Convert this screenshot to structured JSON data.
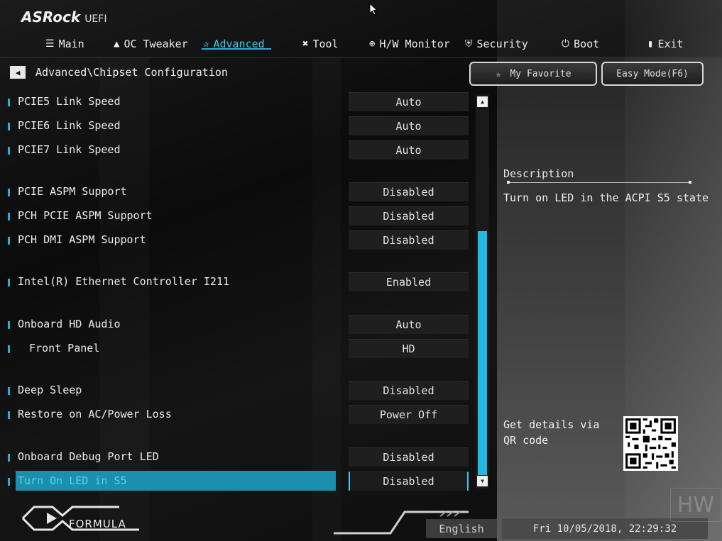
{
  "app": {
    "logo": "ASRock",
    "logo_suffix": "UEFI"
  },
  "tabs": [
    {
      "label": "Main",
      "icon": "list-icon"
    },
    {
      "label": "OC Tweaker",
      "icon": "flame-icon"
    },
    {
      "label": "Advanced",
      "icon": "star-icon",
      "active": true
    },
    {
      "label": "Tool",
      "icon": "tools-icon"
    },
    {
      "label": "H/W Monitor",
      "icon": "monitor-crosshair-icon"
    },
    {
      "label": "Security",
      "icon": "shield-icon"
    },
    {
      "label": "Boot",
      "icon": "power-icon"
    },
    {
      "label": "Exit",
      "icon": "exit-door-icon"
    }
  ],
  "breadcrumb": "Advanced\\Chipset Configuration",
  "buttons": {
    "favorite": "My Favorite",
    "easy_mode": "Easy Mode(F6)"
  },
  "settings": [
    {
      "label": "PCIE5 Link Speed",
      "value": "Auto"
    },
    {
      "label": "PCIE6 Link Speed",
      "value": "Auto"
    },
    {
      "label": "PCIE7 Link Speed",
      "value": "Auto"
    },
    {
      "label": "PCIE ASPM Support",
      "value": "Disabled"
    },
    {
      "label": "PCH PCIE ASPM Support",
      "value": "Disabled"
    },
    {
      "label": "PCH DMI ASPM Support",
      "value": "Disabled"
    },
    {
      "label": "Intel(R) Ethernet Controller I211",
      "value": "Enabled"
    },
    {
      "label": "Onboard HD Audio",
      "value": "Auto"
    },
    {
      "label": "Front Panel",
      "value": "HD"
    },
    {
      "label": "Deep Sleep",
      "value": "Disabled"
    },
    {
      "label": "Restore on AC/Power Loss",
      "value": "Power Off"
    },
    {
      "label": "Onboard Debug Port LED",
      "value": "Disabled"
    },
    {
      "label": "Turn On LED in S5",
      "value": "Disabled",
      "selected": true
    }
  ],
  "description": {
    "title": "Description",
    "text": "Turn on LED in the ACPI S5 state"
  },
  "qr_hint": "Get details via QR code",
  "footer": {
    "brand": "FORMULA",
    "language": "English",
    "datetime": "Fri 10/05/2018, 22:29:32",
    "watermark": "HW"
  },
  "colors": {
    "accent": "#2aaed6",
    "highlight": "#1b8fab",
    "background": "#0e0e0e"
  }
}
